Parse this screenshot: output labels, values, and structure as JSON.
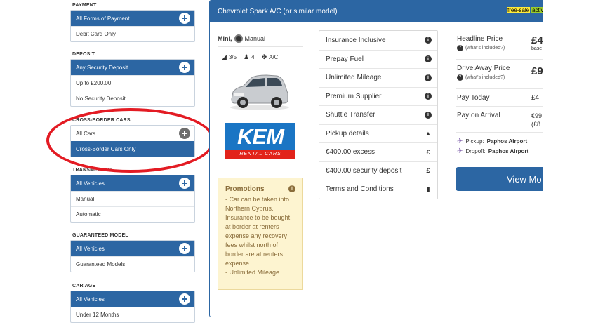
{
  "sidebar": {
    "payment": {
      "title": "PAYMENT",
      "items": [
        "All Forms of Payment",
        "Debit Card Only"
      ]
    },
    "deposit": {
      "title": "DEPOSIT",
      "items": [
        "Any Security Deposit",
        "Up to £200.00",
        "No Security Deposit"
      ]
    },
    "cross_border": {
      "title": "CROSS-BORDER CARS",
      "items": [
        "All Cars",
        "Cross-Border Cars Only"
      ]
    },
    "transmission": {
      "title": "TRANSMISSION",
      "items": [
        "All Vehicles",
        "Manual",
        "Automatic"
      ]
    },
    "guaranteed_model": {
      "title": "GUARANTEED MODEL",
      "items": [
        "All Vehicles",
        "Guaranteed Models"
      ]
    },
    "car_age": {
      "title": "CAR AGE",
      "items": [
        "All Vehicles",
        "Under 12 Months"
      ]
    }
  },
  "card": {
    "title": "Chevrolet Spark A/C (or similar model)",
    "tag_free": "free-sale",
    "tag_active": "activ",
    "category": "Mini,",
    "transmission": "Manual",
    "doors": "3/5",
    "seats": "4",
    "ac": "A/C",
    "supplier_logo": "KEM",
    "supplier_strip": "RENTAL CARS",
    "promo": {
      "title": "Promotions",
      "text": "- Car can be taken into Northern Cyprus. Insurance to be bought at border at renters expense any recovery fees whilst north of border are at renters expense.",
      "text2": "- Unlimited Mileage"
    },
    "features": [
      {
        "label": "Insurance Inclusive",
        "icon": "info-icon"
      },
      {
        "label": "Prepay Fuel",
        "icon": "info-icon"
      },
      {
        "label": "Unlimited Mileage",
        "icon": "info-icon"
      },
      {
        "label": "Premium Supplier",
        "icon": "info-icon"
      },
      {
        "label": "Shuttle Transfer",
        "icon": "info-icon"
      },
      {
        "label": "Pickup details",
        "icon": "road-icon"
      },
      {
        "label": "€400.00 excess",
        "icon": "pound-icon"
      },
      {
        "label": "€400.00 security deposit",
        "icon": "pound-icon"
      },
      {
        "label": "Terms and Conditions",
        "icon": "document-icon"
      }
    ],
    "prices": {
      "headline_label": "Headline Price",
      "headline_sub": "(what's included?)",
      "headline_val": "£4",
      "headline_val_sub": "base",
      "driveaway_label": "Drive Away Price",
      "driveaway_sub": "(what's included?)",
      "driveaway_val": "£9",
      "pay_today_label": "Pay Today",
      "pay_today_val": "£4.",
      "pay_arrival_label": "Pay on Arrival",
      "pay_arrival_val": "€99",
      "pay_arrival_val2": "(£8"
    },
    "pickup_label": "Pickup:",
    "pickup_loc": "Paphos Airport",
    "dropoff_label": "Dropoff:",
    "dropoff_loc": "Paphos Airport",
    "view_button": "View Mo"
  }
}
